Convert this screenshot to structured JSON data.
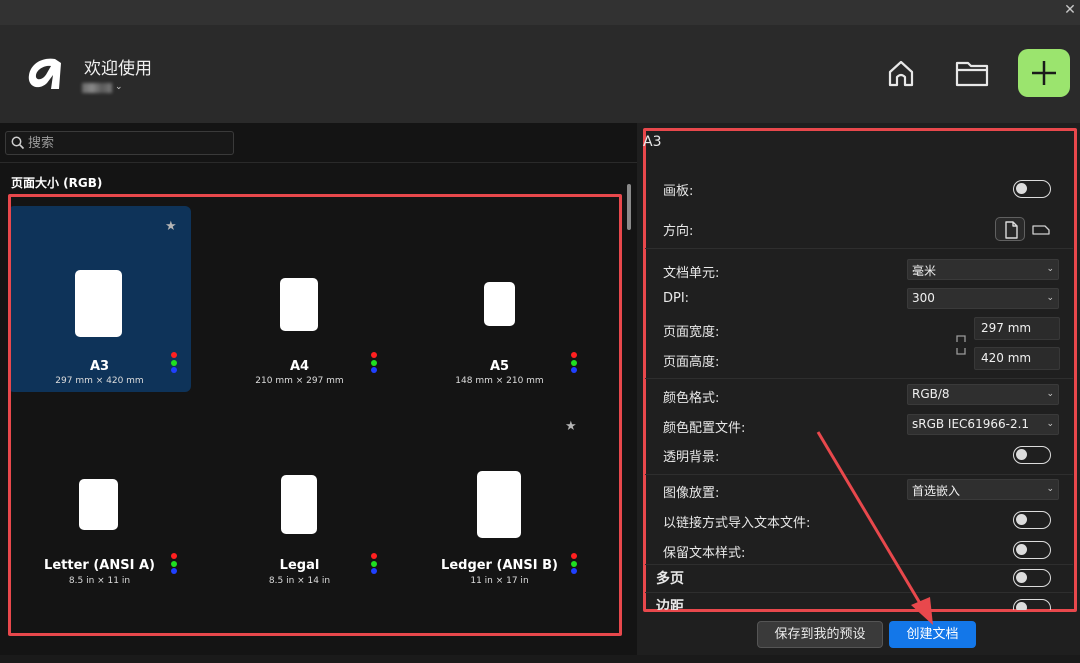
{
  "header": {
    "welcome": "欢迎使用",
    "colors": {
      "accent_new": "#9be46e",
      "highlight": "#e8484c",
      "primary_button": "#1377e9"
    }
  },
  "left": {
    "search_placeholder": "搜索",
    "section_title": "页面大小 (RGB)",
    "presets": [
      {
        "name": "A3",
        "dims": "297 mm × 420 mm"
      },
      {
        "name": "A4",
        "dims": "210 mm × 297 mm"
      },
      {
        "name": "A5",
        "dims": "148 mm × 210 mm"
      },
      {
        "name": "Letter (ANSI A)",
        "dims": "8.5 in × 11 in"
      },
      {
        "name": "Legal",
        "dims": "8.5 in × 14 in"
      },
      {
        "name": "Ledger (ANSI B)",
        "dims": "11 in × 17 in"
      }
    ]
  },
  "right": {
    "title": "A3",
    "artboard_label": "画板:",
    "orientation_label": "方向:",
    "doc_units_label": "文档单元:",
    "doc_units_value": "毫米",
    "dpi_label": "DPI:",
    "dpi_value": "300",
    "width_label": "页面宽度:",
    "width_value": "297 mm",
    "height_label": "页面高度:",
    "height_value": "420 mm",
    "color_format_label": "颜色格式:",
    "color_format_value": "RGB/8",
    "color_profile_label": "颜色配置文件:",
    "color_profile_value": "sRGB IEC61966-2.1",
    "transparent_label": "透明背景:",
    "image_placement_label": "图像放置:",
    "image_placement_value": "首选嵌入",
    "import_linked_label": "以链接方式导入文本文件:",
    "keep_text_style_label": "保留文本样式:",
    "multipage_label": "多页",
    "margins_label": "边距"
  },
  "footer": {
    "save_preset": "保存到我的预设",
    "create_doc": "创建文档"
  }
}
